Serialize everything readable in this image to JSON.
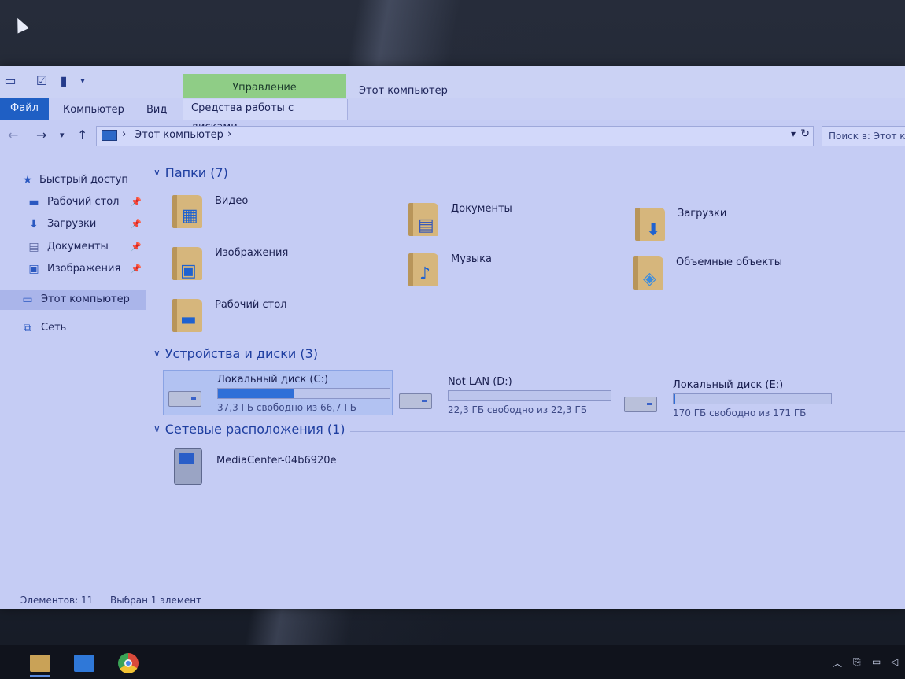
{
  "window": {
    "title": "Этот компьютер",
    "context_group": "Управление",
    "tabs": {
      "file": "Файл",
      "computer": "Компьютер",
      "view": "Вид",
      "disk_tools": "Средства работы с дисками"
    }
  },
  "address": {
    "crumb": "Этот компьютер",
    "search_placeholder": "Поиск в: Этот компьютер"
  },
  "sidebar": {
    "quick_access": "Быстрый доступ",
    "items": [
      "Рабочий стол",
      "Загрузки",
      "Документы",
      "Изображения"
    ],
    "this_pc": "Этот компьютер",
    "network": "Сеть"
  },
  "sections": {
    "folders": "Папки (7)",
    "devices": "Устройства и диски (3)",
    "network": "Сетевые расположения (1)"
  },
  "folders": [
    "Видео",
    "Документы",
    "Загрузки",
    "Изображения",
    "Музыка",
    "Объемные объекты",
    "Рабочий стол"
  ],
  "drives": [
    {
      "name": "Локальный диск (C:)",
      "free_text": "37,3 ГБ свободно из 66,7 ГБ",
      "used_fraction": 0.44
    },
    {
      "name": "Not LAN (D:)",
      "free_text": "22,3 ГБ свободно из 22,3 ГБ",
      "used_fraction": 0.0
    },
    {
      "name": "Локальный диск (E:)",
      "free_text": "170 ГБ свободно из 171 ГБ",
      "used_fraction": 0.01
    }
  ],
  "network_locations": [
    "MediaCenter-04b6920e"
  ],
  "status": {
    "count": "Элементов: 11",
    "selected": "Выбран 1 элемент"
  },
  "colors": {
    "file_tab": "#1f5fc4",
    "context_group": "#8fcd86",
    "disk_bar": "#2f6fd8",
    "selection": "#b2c2f2"
  }
}
